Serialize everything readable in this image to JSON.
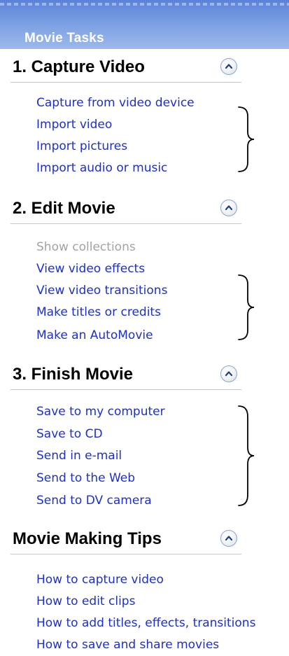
{
  "header": {
    "title": "Movie Tasks"
  },
  "sections": [
    {
      "title": "1. Capture Video",
      "items": [
        {
          "label": "Capture from video device",
          "enabled": true
        },
        {
          "label": "Import video",
          "enabled": true
        },
        {
          "label": "Import pictures",
          "enabled": true
        },
        {
          "label": "Import audio or music",
          "enabled": true
        }
      ]
    },
    {
      "title": "2. Edit Movie",
      "items": [
        {
          "label": "Show collections",
          "enabled": false
        },
        {
          "label": "View video effects",
          "enabled": true
        },
        {
          "label": "View video transitions",
          "enabled": true
        },
        {
          "label": "Make titles or credits",
          "enabled": true
        },
        {
          "label": "Make an AutoMovie",
          "enabled": true
        }
      ]
    },
    {
      "title": "3. Finish Movie",
      "items": [
        {
          "label": "Save to my computer",
          "enabled": true
        },
        {
          "label": "Save to CD",
          "enabled": true
        },
        {
          "label": "Send in e-mail",
          "enabled": true
        },
        {
          "label": "Send to the Web",
          "enabled": true
        },
        {
          "label": "Send to DV camera",
          "enabled": true
        }
      ]
    },
    {
      "title": "Movie Making Tips",
      "items": [
        {
          "label": "How to capture video",
          "enabled": true
        },
        {
          "label": "How to edit clips",
          "enabled": true
        },
        {
          "label": "How to add titles, effects, transitions",
          "enabled": true
        },
        {
          "label": "How to save and share movies",
          "enabled": true
        }
      ]
    }
  ],
  "icons": {
    "collapse": "chevron-up-icon",
    "annotation": "curly-brace-icon"
  },
  "colors": {
    "link": "#1c2fd6",
    "disabled": "#a3a3a3",
    "header_gradient_top": "#5b82d8",
    "header_gradient_bottom": "#9db9ec"
  }
}
